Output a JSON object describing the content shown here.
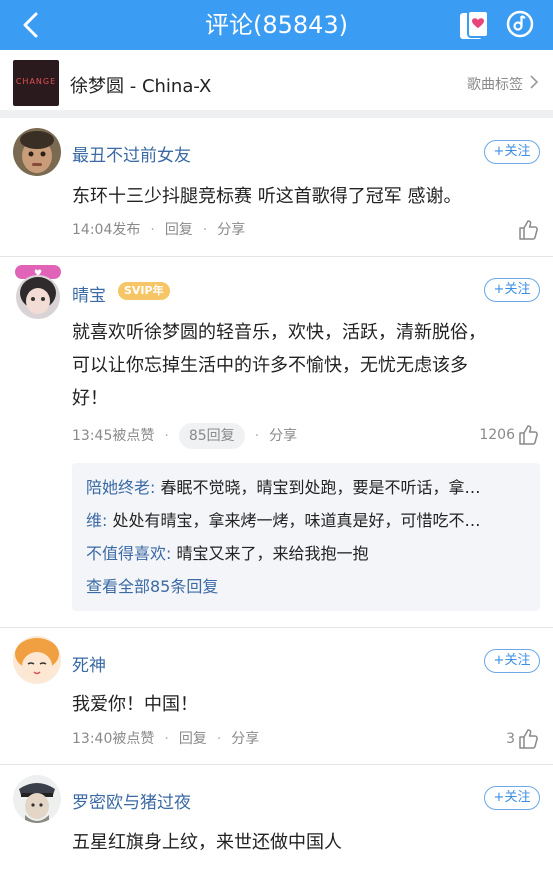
{
  "header": {
    "title": "评论(85843)",
    "bg_color": "#3a9cf2"
  },
  "song": {
    "cover_text": "CHANGE",
    "name": "徐梦圆 - China-X",
    "tag_label": "歌曲标签"
  },
  "comments": [
    {
      "username": "最丑不过前女友",
      "follow_label": "+关注",
      "text": "东环十三少抖腿竞标赛 听这首歌得了冠军  感谢。",
      "time": "14:04发布",
      "reply_label": "回复",
      "share_label": "分享"
    },
    {
      "username": "晴宝",
      "badge": "SVIP年",
      "follow_label": "+关注",
      "text_lines": [
        "就喜欢听徐梦圆的轻音乐，欢快，活跃，清新脱俗，",
        "可以让你忘掉生活中的许多不愉快，无忧无虑该多",
        "好！"
      ],
      "time": "13:45被点赞",
      "reply_count_label": "85回复",
      "share_label": "分享",
      "likes": "1206",
      "replies": [
        {
          "name": "陪她终老:",
          "text": " 春眠不觉晓，晴宝到处跑，要是不听话，拿…"
        },
        {
          "name": "维:",
          "text": " 处处有晴宝，拿来烤一烤，味道真是好，可惜吃不…"
        },
        {
          "name": "不值得喜欢:",
          "text": " 晴宝又来了，来给我抱一抱"
        }
      ],
      "view_all_label": "查看全部85条回复"
    },
    {
      "username": "死神",
      "follow_label": "+关注",
      "text": "我爱你！中国！",
      "time": "13:40被点赞",
      "reply_label": "回复",
      "share_label": "分享",
      "likes": "3"
    },
    {
      "username": "罗密欧与猪过夜",
      "follow_label": "+关注",
      "text": "五星红旗身上纹，来世还做中国人"
    }
  ]
}
